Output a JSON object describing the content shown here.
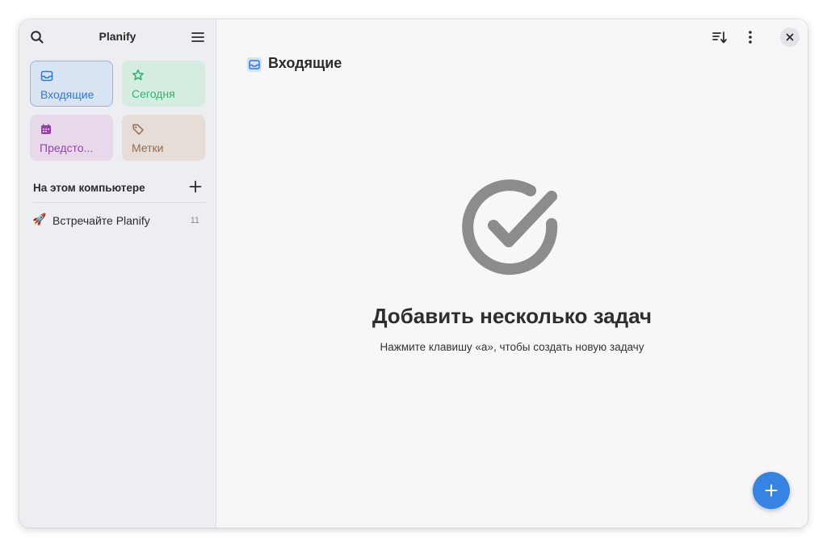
{
  "app": {
    "title": "Planify"
  },
  "colors": {
    "accent": "#3584e4",
    "inbox": "#2f78d9",
    "today": "#36b26d",
    "upcoming": "#9a3fb0",
    "labels": "#8f6b4f"
  },
  "sidebar": {
    "tiles": [
      {
        "label": "Входящие",
        "icon": "inbox-icon"
      },
      {
        "label": "Сегодня",
        "icon": "star-icon"
      },
      {
        "label": "Предсто...",
        "icon": "calendar-icon"
      },
      {
        "label": "Метки",
        "icon": "tag-icon"
      }
    ],
    "section": {
      "title": "На этом компьютере",
      "projects": [
        {
          "icon": "🚀",
          "name": "Встречайте Planify",
          "count": "11"
        }
      ]
    }
  },
  "main": {
    "title": "Входящие",
    "empty": {
      "title": "Добавить несколько задач",
      "subtitle": "Нажмите клавишу «а», чтобы создать новую задачу"
    }
  }
}
